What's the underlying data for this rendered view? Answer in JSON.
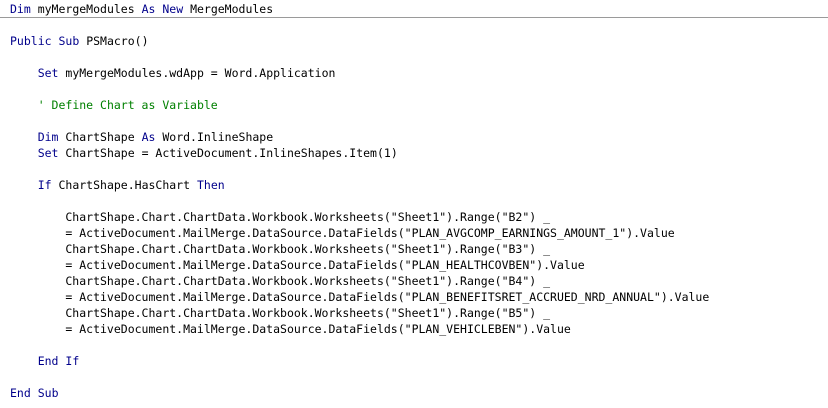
{
  "colors": {
    "keyword": "#00008b",
    "comment": "#008000",
    "text": "#000000",
    "background": "#ffffff"
  },
  "code_lines": [
    [
      {
        "t": "Dim",
        "c": "kw"
      },
      {
        "t": " myMergeModules "
      },
      {
        "t": "As",
        "c": "kw"
      },
      {
        "t": " "
      },
      {
        "t": "New",
        "c": "kw"
      },
      {
        "t": " MergeModules"
      }
    ],
    [],
    [
      {
        "t": "Public",
        "c": "kw"
      },
      {
        "t": " "
      },
      {
        "t": "Sub",
        "c": "kw"
      },
      {
        "t": " PSMacro()"
      }
    ],
    [],
    [
      {
        "t": "    "
      },
      {
        "t": "Set",
        "c": "kw"
      },
      {
        "t": " myMergeModules.wdApp = Word.Application"
      }
    ],
    [],
    [
      {
        "t": "    "
      },
      {
        "t": "' Define Chart as Variable",
        "c": "cm"
      }
    ],
    [],
    [
      {
        "t": "    "
      },
      {
        "t": "Dim",
        "c": "kw"
      },
      {
        "t": " ChartShape "
      },
      {
        "t": "As",
        "c": "kw"
      },
      {
        "t": " Word.InlineShape"
      }
    ],
    [
      {
        "t": "    "
      },
      {
        "t": "Set",
        "c": "kw"
      },
      {
        "t": " ChartShape = ActiveDocument.InlineShapes.Item(1)"
      }
    ],
    [],
    [
      {
        "t": "    "
      },
      {
        "t": "If",
        "c": "kw"
      },
      {
        "t": " ChartShape.HasChart "
      },
      {
        "t": "Then",
        "c": "kw"
      }
    ],
    [],
    [
      {
        "t": "        ChartShape.Chart.ChartData.Workbook.Worksheets(\"Sheet1\").Range(\"B2\") _"
      }
    ],
    [
      {
        "t": "        = ActiveDocument.MailMerge.DataSource.DataFields(\"PLAN_AVGCOMP_EARNINGS_AMOUNT_1\").Value"
      }
    ],
    [
      {
        "t": "        ChartShape.Chart.ChartData.Workbook.Worksheets(\"Sheet1\").Range(\"B3\") _"
      }
    ],
    [
      {
        "t": "        = ActiveDocument.MailMerge.DataSource.DataFields(\"PLAN_HEALTHCOVBEN\").Value"
      }
    ],
    [
      {
        "t": "        ChartShape.Chart.ChartData.Workbook.Worksheets(\"Sheet1\").Range(\"B4\") _"
      }
    ],
    [
      {
        "t": "        = ActiveDocument.MailMerge.DataSource.DataFields(\"PLAN_BENEFITSRET_ACCRUED_NRD_ANNUAL\").Value"
      }
    ],
    [
      {
        "t": "        ChartShape.Chart.ChartData.Workbook.Worksheets(\"Sheet1\").Range(\"B5\") _"
      }
    ],
    [
      {
        "t": "        = ActiveDocument.MailMerge.DataSource.DataFields(\"PLAN_VEHICLEBEN\").Value"
      }
    ],
    [],
    [
      {
        "t": "    "
      },
      {
        "t": "End",
        "c": "kw"
      },
      {
        "t": " "
      },
      {
        "t": "If",
        "c": "kw"
      }
    ],
    [],
    [
      {
        "t": "End",
        "c": "kw"
      },
      {
        "t": " "
      },
      {
        "t": "Sub",
        "c": "kw"
      }
    ]
  ]
}
